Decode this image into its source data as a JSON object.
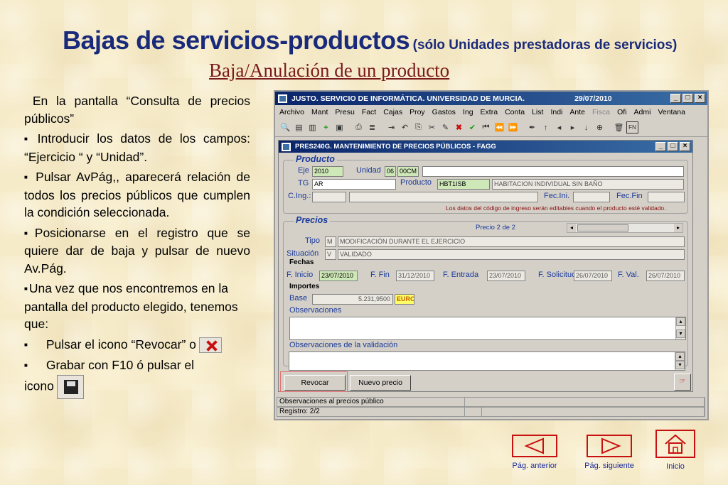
{
  "title": {
    "main": "Bajas de servicios-productos",
    "sub": "(sólo Unidades prestadoras de servicios)"
  },
  "subtitle": "Baja/Anulación de un producto",
  "instructions": {
    "p1": "En la pantalla “Consulta de precios públicos”",
    "p2": "Introducir los datos de los campos: “Ejercicio “ y “Unidad”.",
    "p3": "Pulsar AvPág,, aparecerá relación de todos los precios públicos que cumplen la condición seleccionada.",
    "p4": "Posicionarse en el registro que se quiere dar de baja y pulsar de nuevo Av.Pág.",
    "p5": "Una vez que nos encontremos en la pantalla del producto elegido, tenemos que:",
    "p6": "Pulsar el icono “Revocar” o",
    "p7a": "Grabar con F10 ó pulsar el",
    "p7b": "icono"
  },
  "app": {
    "title": "JUSTO. SERVICIO DE INFORMÁTICA. UNIVERSIDAD DE MURCIA.",
    "date": "29/07/2010",
    "menu": [
      "Archivo",
      "Mant",
      "Presu",
      "Fact",
      "Cajas",
      "Proy",
      "Gastos",
      "Ing",
      "Extra",
      "Conta",
      "List",
      "Indi",
      "Ante",
      "Fisca",
      "Ofi",
      "Admi",
      "Ventana"
    ],
    "inner_title": "PRES240G. MANTENIMIENTO DE PRECIOS PÚBLICOS - FAGG",
    "producto": {
      "legend": "Producto",
      "eje_label": "Eje",
      "eje_value": "2010",
      "unidad_label": "Unidad",
      "unidad_value1": "06",
      "unidad_value2": "00CM",
      "tg_label": "TG",
      "tg_value": "AR",
      "producto_label": "Producto",
      "producto_code": "HBT1ISB",
      "producto_desc": "HABITACION INDIVIDUAL SIN BAÑO",
      "cing_label": "C.Ing.:",
      "fecini_label": "Fec.Ini.",
      "fecfin_label": "Fec.Fin",
      "note": "Los datos del código de ingreso serán editables cuando el producto esté validado."
    },
    "precios": {
      "legend": "Precios",
      "counter": "Precio 2 de 2",
      "tipo_label": "Tipo",
      "tipo_code": "M",
      "tipo_desc": "MODIFICACIÓN DURANTE EL EJERCICIO",
      "situacion_label": "Situación",
      "situacion_code": "V",
      "situacion_desc": "VALIDADO",
      "fechas_label": "Fechas",
      "finicio_label": "F. Inicio",
      "finicio_value": "23/07/2010",
      "ffin_label": "F. Fin",
      "ffin_value": "31/12/2010",
      "fentrada_label": "F. Entrada",
      "fentrada_value": "23/07/2010",
      "fsolicitud_label": "F. Solicitud",
      "fsolicitud_value": "26/07/2010",
      "fval_label": "F. Val.",
      "fval_value": "26/07/2010",
      "importes_label": "Importes",
      "base_label": "Base",
      "base_value": "5.231,9500",
      "currency": "EURO",
      "obs_label": "Observaciones",
      "obs_val_label": "Observaciones de la validación"
    },
    "buttons": {
      "revocar": "Revocar",
      "nuevo_precio": "Nuevo precio"
    },
    "status": {
      "line1": "Observaciones al precios público",
      "line2": "Registro: 2/2"
    }
  },
  "nav": {
    "prev": "Pág. anterior",
    "next": "Pág. siguiente",
    "home": "Inicio"
  },
  "colors": {
    "title": "#1a2a7a",
    "subtitle": "#7a1a1a",
    "nav_border": "#c81010"
  }
}
